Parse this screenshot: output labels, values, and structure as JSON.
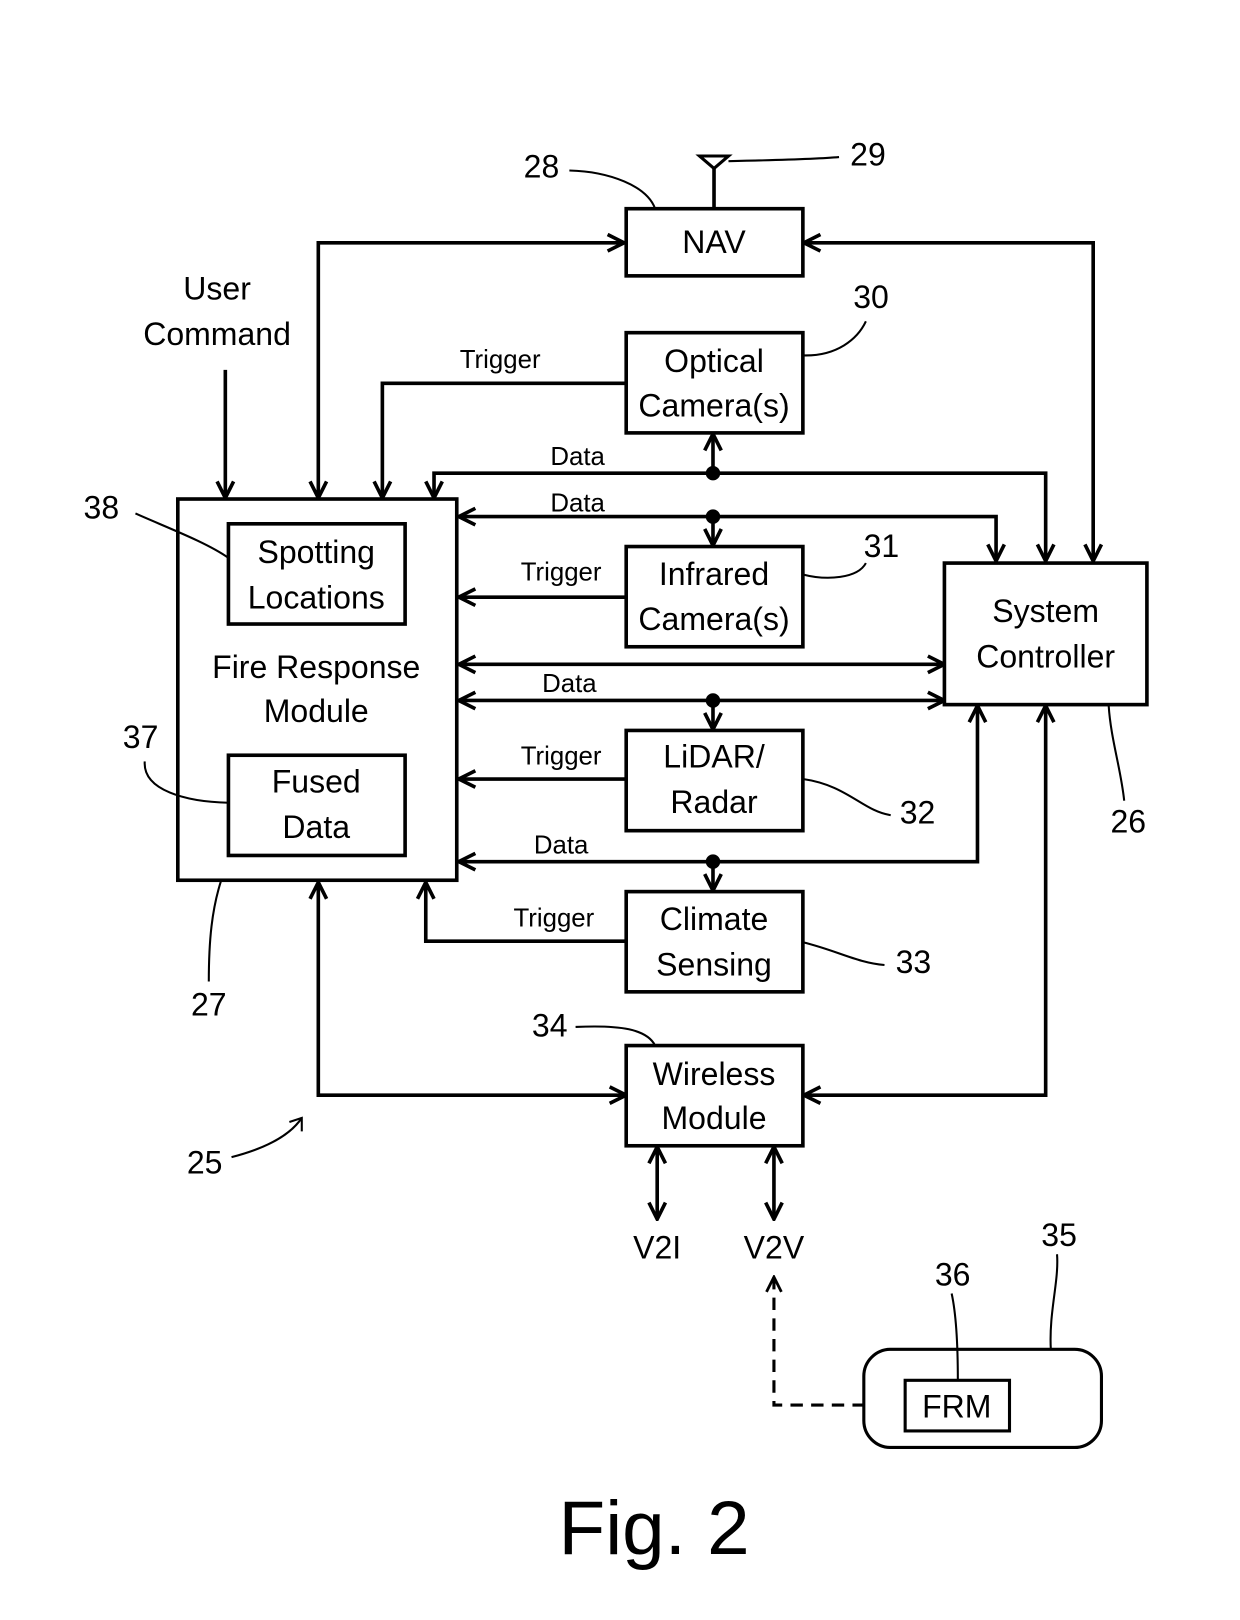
{
  "figure": {
    "caption": "Fig. 2",
    "system_ref": "25"
  },
  "blocks": {
    "nav": {
      "label": "NAV",
      "ref": "28",
      "antenna_ref": "29"
    },
    "optical_camera": {
      "line1": "Optical",
      "line2": "Camera(s)",
      "ref": "30"
    },
    "infrared_camera": {
      "line1": "Infrared",
      "line2": "Camera(s)",
      "ref": "31"
    },
    "lidar_radar": {
      "line1": "LiDAR/",
      "line2": "Radar",
      "ref": "32"
    },
    "climate_sensing": {
      "line1": "Climate",
      "line2": "Sensing",
      "ref": "33"
    },
    "wireless_module": {
      "line1": "Wireless",
      "line2": "Module",
      "ref": "34"
    },
    "system_controller": {
      "line1": "System",
      "line2": "Controller",
      "ref": "26"
    },
    "fire_response_module": {
      "line1": "Fire Response",
      "line2": "Module",
      "ref": "27"
    },
    "spotting_locations": {
      "line1": "Spotting",
      "line2": "Locations",
      "ref": "38"
    },
    "fused_data": {
      "line1": "Fused",
      "line2": "Data",
      "ref": "37"
    },
    "remote_vehicle": {
      "ref": "35"
    },
    "remote_frm": {
      "label": "FRM",
      "ref": "36"
    }
  },
  "inputs": {
    "user_command_line1": "User",
    "user_command_line2": "Command"
  },
  "signals": {
    "trigger": "Trigger",
    "data": "Data",
    "v2i": "V2I",
    "v2v": "V2V"
  }
}
